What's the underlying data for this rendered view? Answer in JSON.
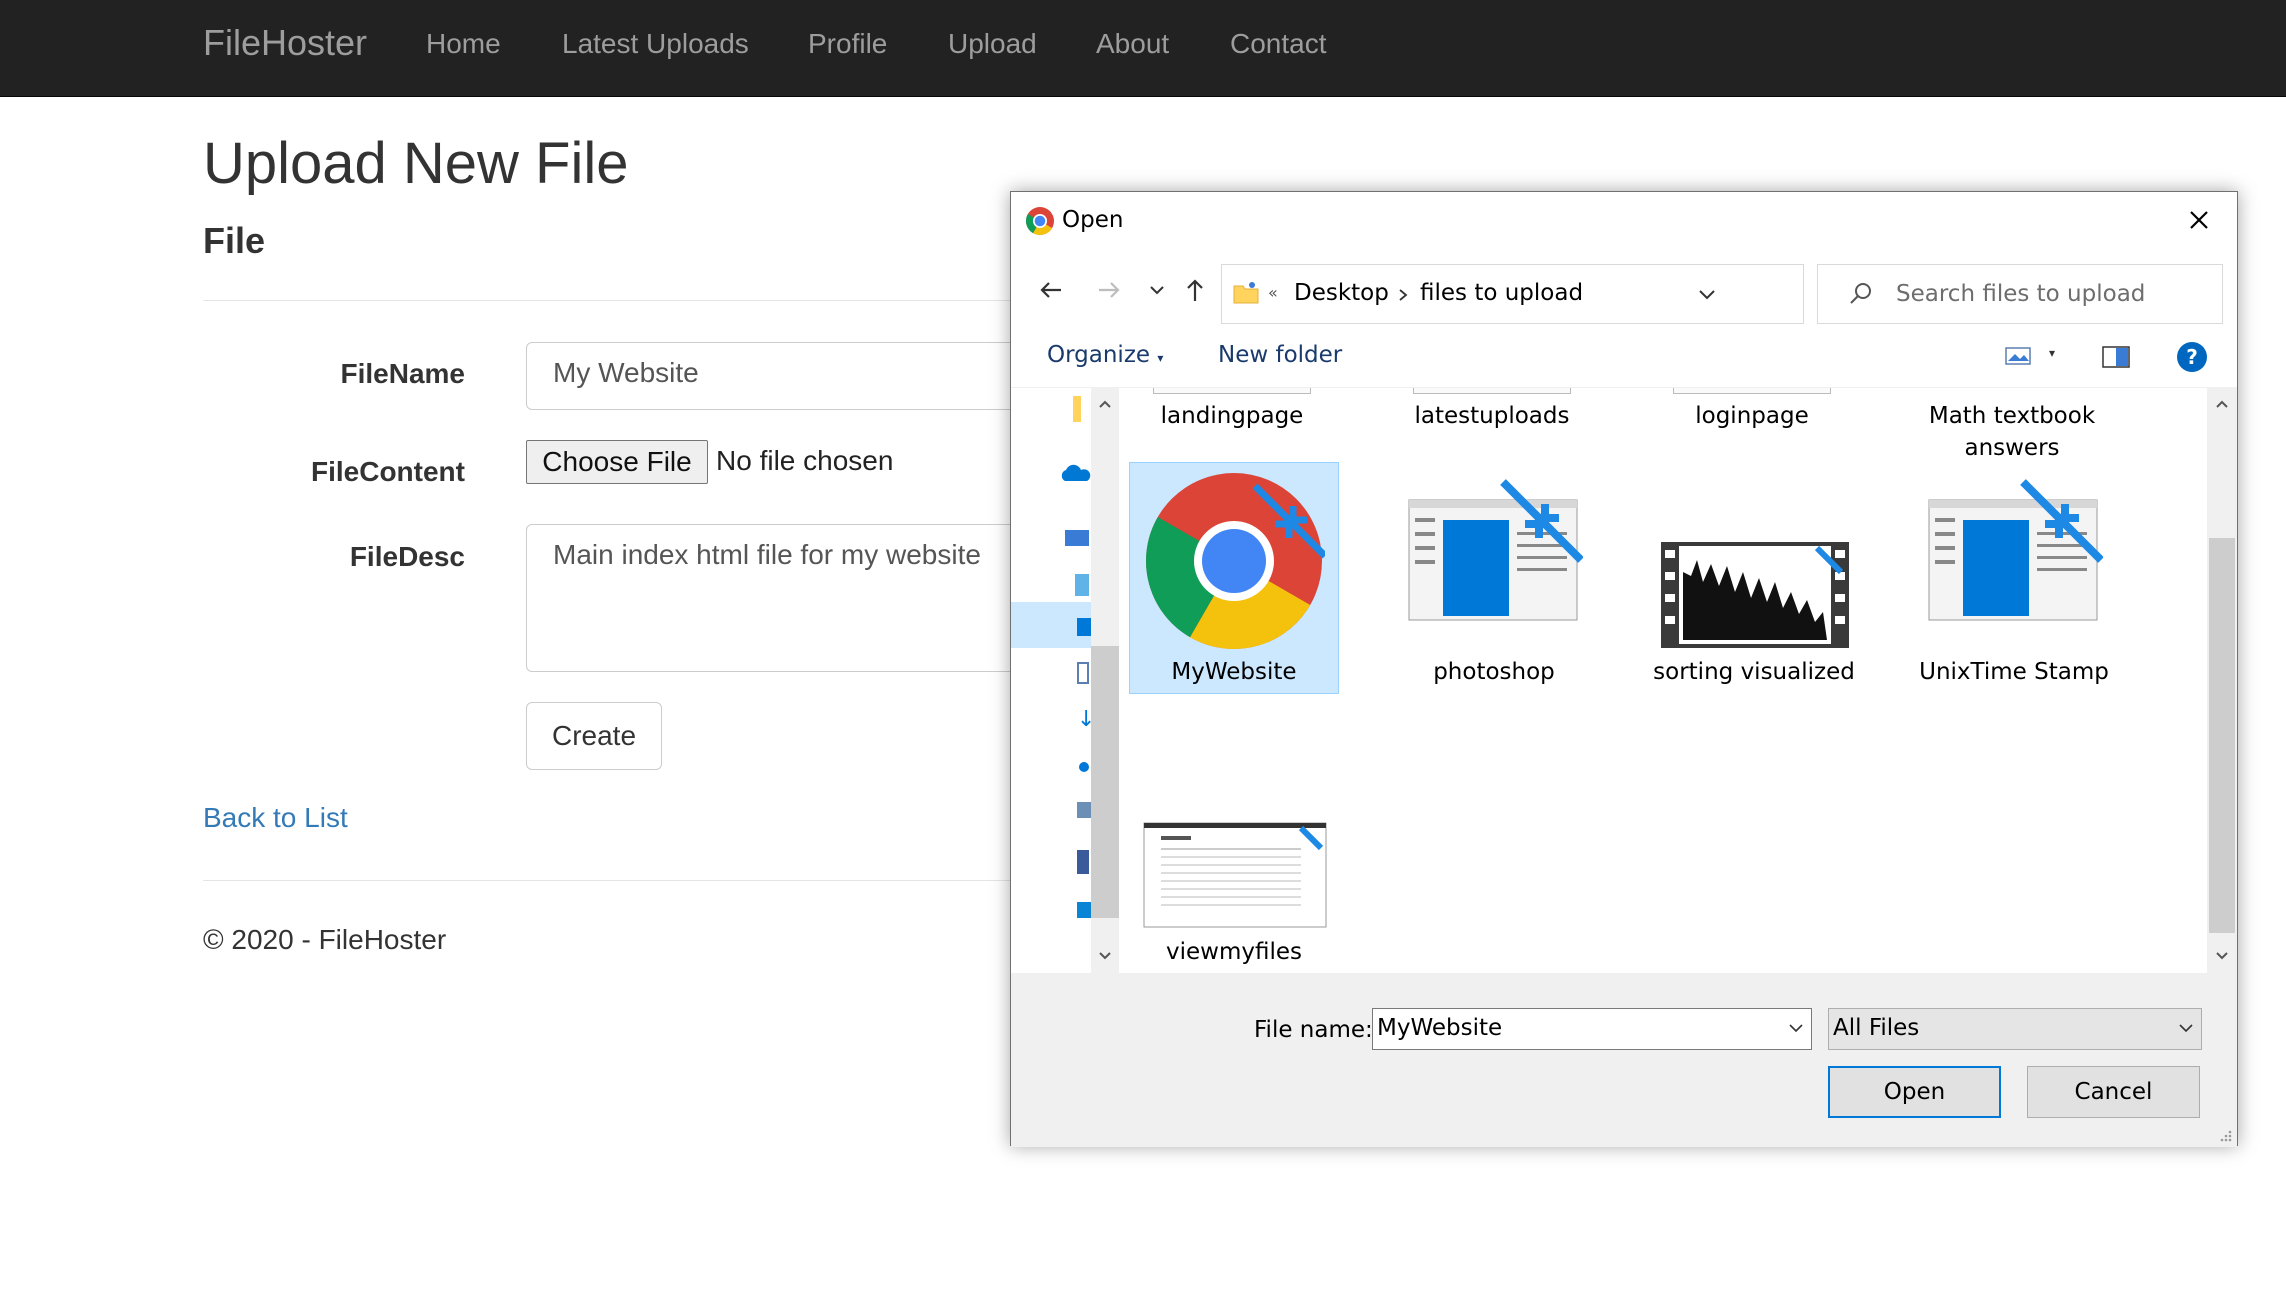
{
  "navbar": {
    "brand": "FileHoster",
    "items": [
      "Home",
      "Latest Uploads",
      "Profile",
      "Upload",
      "About",
      "Contact"
    ]
  },
  "page": {
    "title": "Upload New File",
    "subtitle": "File",
    "fields": {
      "filename_label": "FileName",
      "filename_value": "My Website",
      "filecontent_label": "FileContent",
      "choose_file": "Choose File",
      "no_file": "No file chosen",
      "filedesc_label": "FileDesc",
      "filedesc_value": "Main index html file for my website"
    },
    "create_button": "Create",
    "back_link": "Back to List",
    "footer": "© 2020 - FileHoster"
  },
  "dialog": {
    "title": "Open",
    "breadcrumb": [
      "Desktop",
      "files to upload"
    ],
    "search_placeholder": "Search files to upload",
    "organize": "Organize",
    "new_folder": "New folder",
    "files": [
      {
        "name": "landingpage",
        "icon": "image-thumbnail-icon"
      },
      {
        "name": "latestuploads",
        "icon": "image-thumbnail-icon"
      },
      {
        "name": "loginpage",
        "icon": "image-thumbnail-icon"
      },
      {
        "name": "Math textbook answers",
        "icon": "file-icon"
      },
      {
        "name": "MyWebsite",
        "icon": "chrome-shortcut-icon",
        "selected": true
      },
      {
        "name": "photoshop",
        "icon": "app-shortcut-icon"
      },
      {
        "name": "sorting visualized",
        "icon": "video-thumbnail-icon"
      },
      {
        "name": "UnixTime Stamp",
        "icon": "app-shortcut-icon"
      },
      {
        "name": "viewmyfiles",
        "icon": "image-thumbnail-icon"
      }
    ],
    "file_name_label": "File name:",
    "file_name_value": "MyWebsite",
    "file_type": "All Files",
    "open_button": "Open",
    "cancel_button": "Cancel"
  },
  "colors": {
    "navbar_bg": "#222222",
    "nav_text": "#9d9d9d",
    "link": "#337ab7",
    "selection": "#cce8ff",
    "accent": "#0078d7"
  }
}
